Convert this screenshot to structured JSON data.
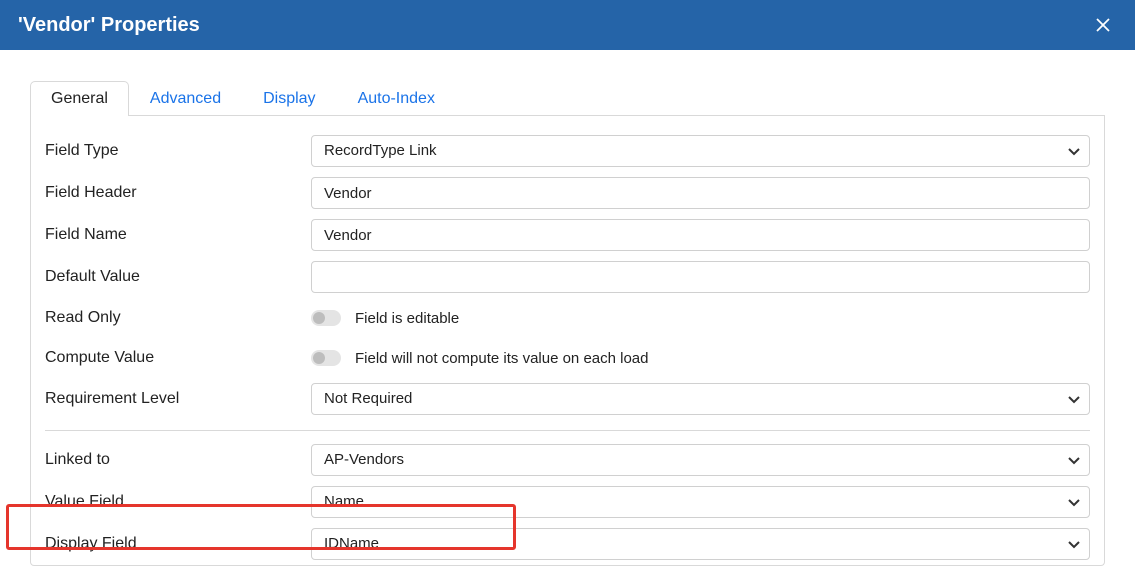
{
  "header": {
    "title": "'Vendor' Properties"
  },
  "tabs": {
    "general": "General",
    "advanced": "Advanced",
    "display": "Display",
    "auto_index": "Auto-Index"
  },
  "labels": {
    "field_type": "Field Type",
    "field_header": "Field Header",
    "field_name": "Field Name",
    "default_value": "Default Value",
    "read_only": "Read Only",
    "compute_value": "Compute Value",
    "requirement_level": "Requirement Level",
    "linked_to": "Linked to",
    "value_field": "Value Field",
    "display_field": "Display Field"
  },
  "values": {
    "field_type": "RecordType Link",
    "field_header": "Vendor",
    "field_name": "Vendor",
    "default_value": "",
    "read_only_desc": "Field is editable",
    "compute_value_desc": "Field will not compute its value on each load",
    "requirement_level": "Not Required",
    "linked_to": "AP-Vendors",
    "value_field": "Name",
    "display_field": "IDName"
  },
  "state": {
    "read_only": false,
    "compute_value": false
  }
}
